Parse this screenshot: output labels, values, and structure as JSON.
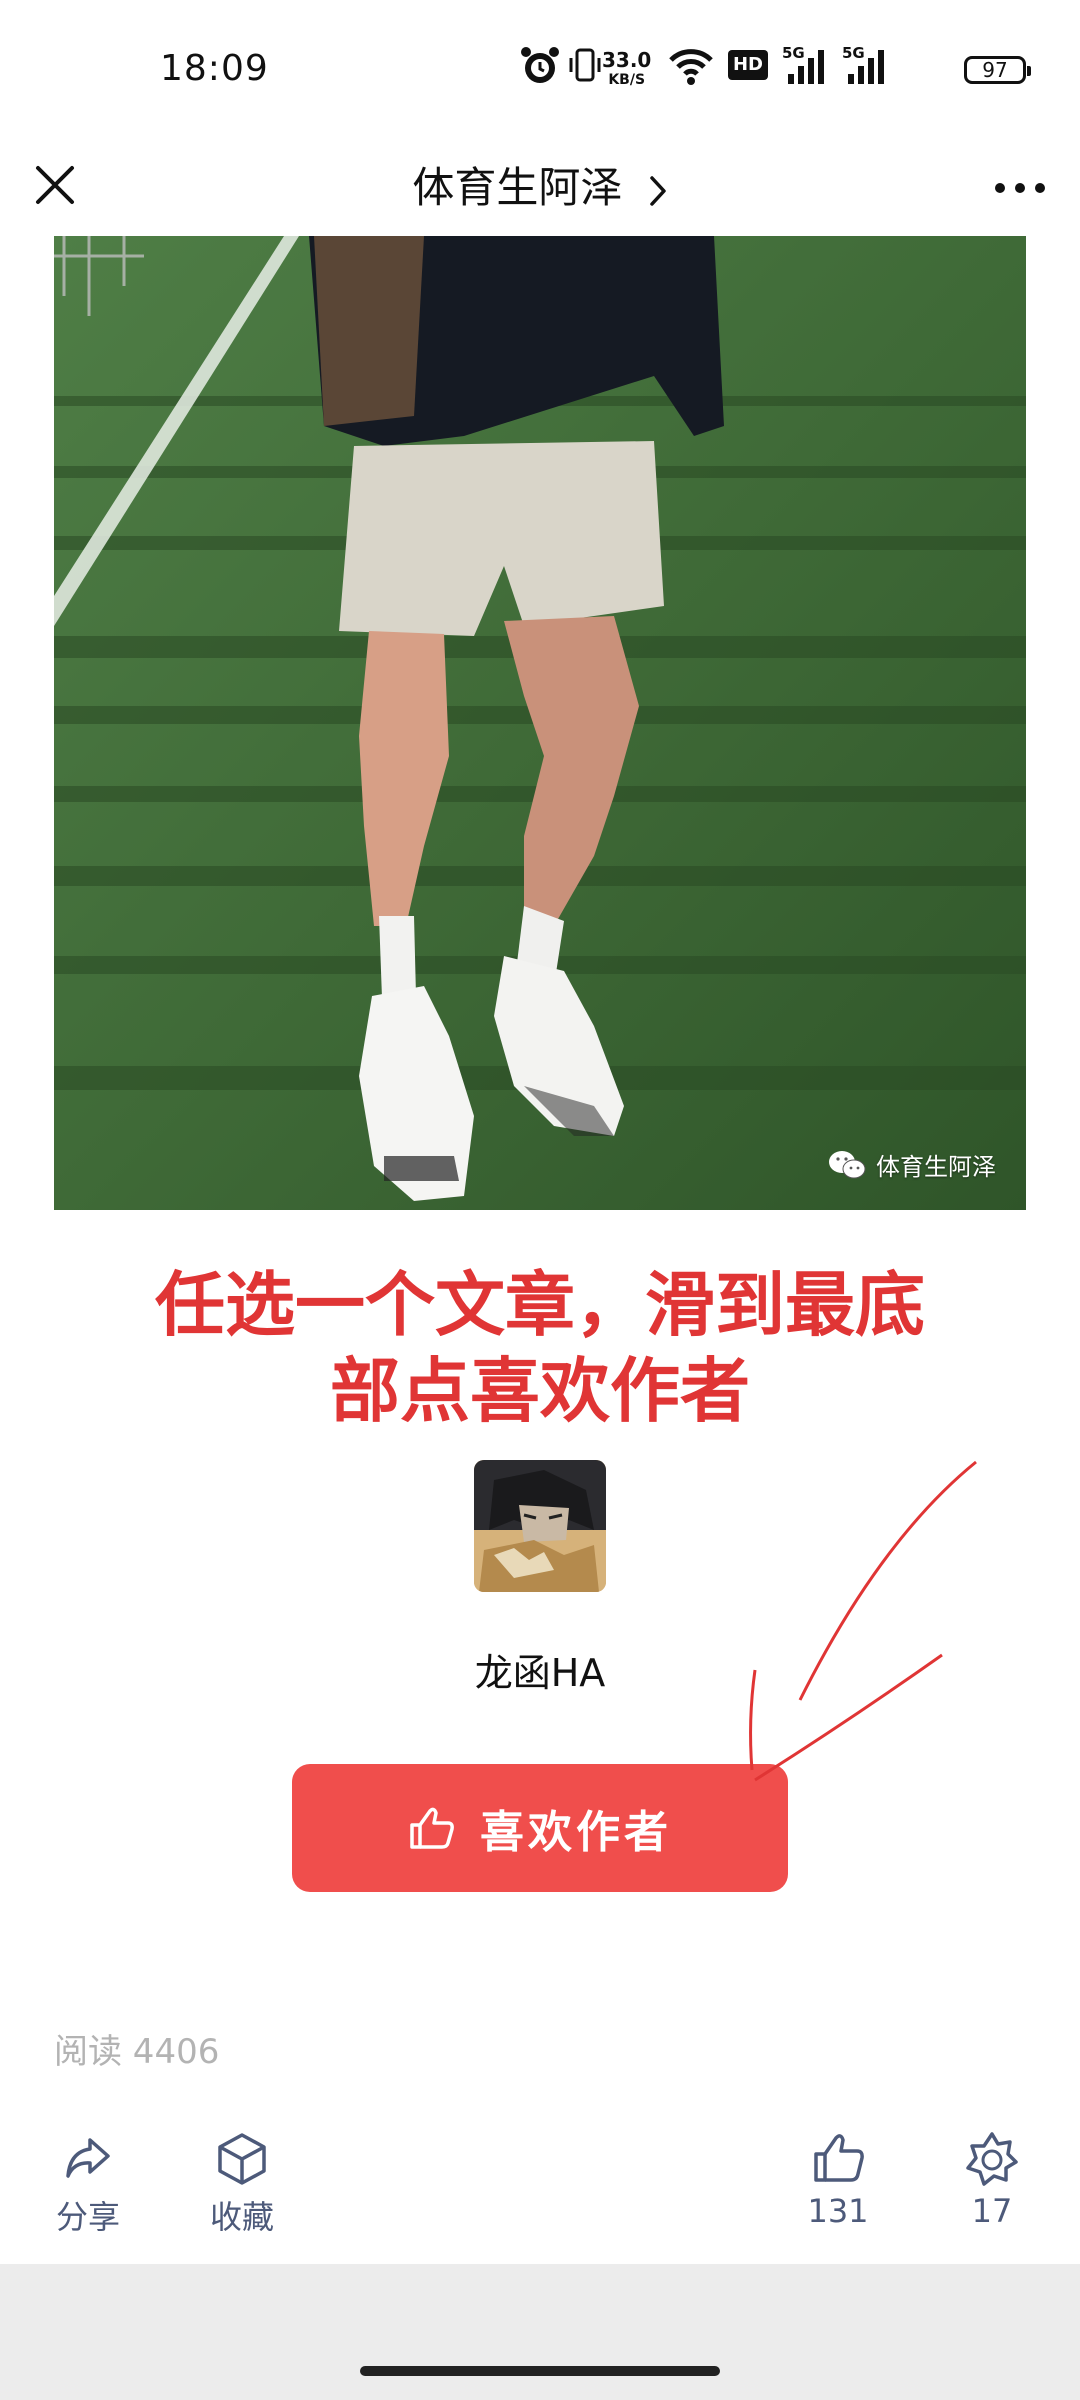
{
  "status_bar": {
    "time": "18:09",
    "net_speed": "33.0",
    "net_speed_unit": "KB/S",
    "hd_label": "HD",
    "signal1_label": "5G",
    "signal2_label": "5G",
    "battery": "97",
    "icons": [
      "alarm-icon",
      "vibrate-icon",
      "wifi-icon",
      "hd-icon",
      "signal-icon",
      "signal-icon",
      "battery-icon"
    ]
  },
  "nav": {
    "title": "体育生阿泽",
    "icons": [
      "close-icon",
      "chevron-right-icon",
      "more-icon"
    ]
  },
  "photo": {
    "watermark": "体育生阿泽"
  },
  "annotation": {
    "line1": "任选一个文章，滑到最底",
    "line2": "部点喜欢作者",
    "color": "#e03535"
  },
  "author": {
    "name": "龙函HA",
    "button_label": "喜欢作者"
  },
  "stats": {
    "read_count": "阅读 4406"
  },
  "bottom_bar": {
    "share_label": "分享",
    "collect_label": "收藏",
    "like_count": "131",
    "wow_count": "17"
  },
  "colors": {
    "accent": "#f04e4c",
    "icon": "#4d5a7a",
    "muted_text": "#b3b3b3"
  }
}
